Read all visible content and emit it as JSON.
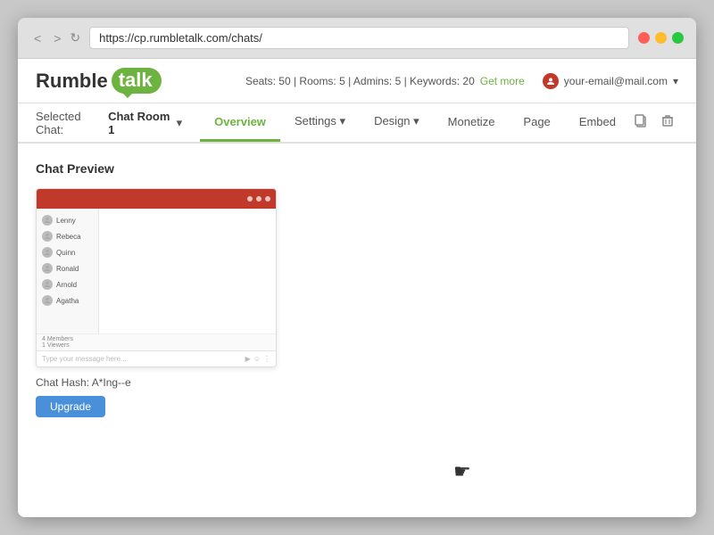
{
  "browser": {
    "url": "https://cp.rumbletalk.com/chats/",
    "back_label": "<",
    "forward_label": ">",
    "refresh_label": "↻"
  },
  "window_controls": {
    "red_label": "",
    "yellow_label": "",
    "green_label": ""
  },
  "header": {
    "logo_rumble": "Rumble",
    "logo_talk": "talk",
    "seats_info": "Seats: 50 | Rooms: 5 | Admins: 5 | Keywords: 20",
    "get_more": "Get more",
    "user_email": "your-email@mail.com"
  },
  "navbar": {
    "selected_chat_label": "Selected Chat:",
    "selected_chat_name": "Chat Room 1",
    "tabs": [
      {
        "id": "overview",
        "label": "Overview",
        "active": true,
        "has_arrow": false
      },
      {
        "id": "settings",
        "label": "Settings",
        "active": false,
        "has_arrow": true
      },
      {
        "id": "design",
        "label": "Design",
        "active": false,
        "has_arrow": true
      },
      {
        "id": "monetize",
        "label": "Monetize",
        "active": false,
        "has_arrow": false
      },
      {
        "id": "page",
        "label": "Page",
        "active": false,
        "has_arrow": false
      },
      {
        "id": "embed",
        "label": "Embed",
        "active": false,
        "has_arrow": false
      }
    ]
  },
  "main": {
    "section_title": "Chat Preview",
    "chat_users": [
      {
        "name": "Lenny"
      },
      {
        "name": "Rebeca"
      },
      {
        "name": "Quinn"
      },
      {
        "name": "Ronald"
      },
      {
        "name": "Arnold"
      },
      {
        "name": "Agatha"
      }
    ],
    "chat_input_placeholder": "Type your message here...",
    "chat_stats": "4 Members\n1 Viewers",
    "chat_hash_label": "Chat Hash:",
    "chat_hash_value": "A*Ing--e",
    "upgrade_button": "Upgrade"
  }
}
